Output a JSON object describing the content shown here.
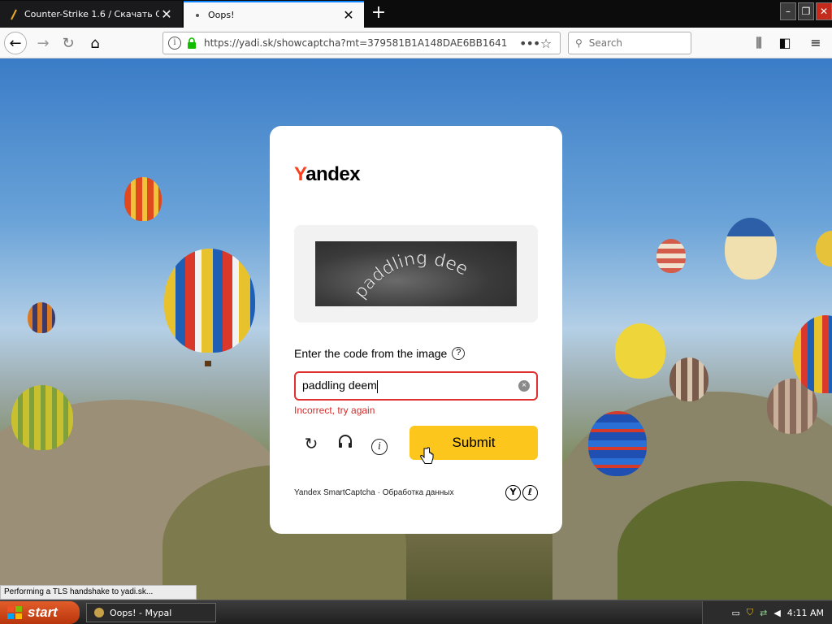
{
  "browser": {
    "tabs": [
      {
        "title": "Counter-Strike 1.6 / Скачать CS",
        "close": "✕"
      },
      {
        "title": "Oops!",
        "close": "✕"
      }
    ],
    "new_tab": "+",
    "window_buttons": {
      "minimize": "–",
      "maximize": "❐",
      "close": "✕"
    },
    "url": "https://yadi.sk/showcaptcha?mt=379581B1A148DAE6BB1641",
    "search_placeholder": "Search",
    "status_text": "Performing a TLS handshake to yadi.sk..."
  },
  "icons": {
    "back": "←",
    "forward": "→",
    "reload": "↻",
    "home": "⌂",
    "info": "i",
    "page_actions": "•••",
    "bookmark": "☆",
    "search": "⚲",
    "library": "⫼",
    "sidebar": "◧",
    "menu": "≡"
  },
  "captcha": {
    "logo_first": "Y",
    "logo_rest": "andex",
    "captcha_text": "paddling deem",
    "prompt": "Enter the code from the image",
    "help": "?",
    "input_value": "paddling deem",
    "clear": "×",
    "error": "Incorrect, try again",
    "refresh_icon": "↻",
    "audio_icon": "🎧",
    "info_icon": "i",
    "submit": "Submit",
    "footer": "Yandex SmartCaptcha · Обработка данных",
    "footer_badges": [
      "Y",
      "ℓ"
    ]
  },
  "taskbar": {
    "start": "start",
    "task": "Oops! - Mypal",
    "time": "4:11 AM"
  },
  "colors": {
    "submit_bg": "#fcc61d",
    "error": "#d62b2b",
    "yandex_red": "#fc3f1d",
    "tab_accent": "#0a84ff"
  }
}
